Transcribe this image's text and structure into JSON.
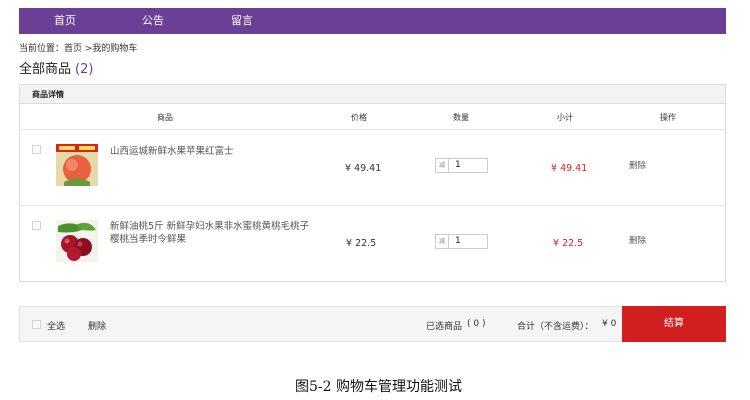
{
  "nav": {
    "items": [
      {
        "label": "首页"
      },
      {
        "label": "公告"
      },
      {
        "label": "留言"
      }
    ]
  },
  "breadcrumb": {
    "text": "当前位置：首页 >我的购物车"
  },
  "page": {
    "title": "全部商品",
    "count": "(2)"
  },
  "panel": {
    "header": "商品详情",
    "columns": [
      "商品",
      "价格",
      "数量",
      "小计",
      "操作"
    ]
  },
  "products": [
    {
      "name": "山西运城新鲜水果苹果红富士",
      "name_line2": "",
      "price": "¥ 49.41",
      "qty_minus": "减",
      "qty": "1",
      "subtotal": "¥ 49.41",
      "delete": "删除",
      "image_icon": "red-apple-product-image"
    },
    {
      "name": "新鲜油桃5斤 新鲜孕妇水果非水蜜桃黄桃毛桃子",
      "name_line2": "樱桃当季时令鲜果",
      "price": "¥ 22.5",
      "qty_minus": "减",
      "qty": "1",
      "subtotal": "¥ 22.5",
      "delete": "删除",
      "image_icon": "cherries-product-image"
    }
  ],
  "footer": {
    "select_all": "全选",
    "delete": "删除",
    "selected_label": "已选商品",
    "selected_count": "( 0 )",
    "total_label": "合计（不含运费）：",
    "total_value": "¥ 0",
    "checkout": "结算"
  },
  "caption": "图5-2 购物车管理功能测试",
  "colors": {
    "nav_bg": "#6b3f96",
    "accent_red": "#e02020",
    "checkout_bg": "#d11f1f"
  }
}
